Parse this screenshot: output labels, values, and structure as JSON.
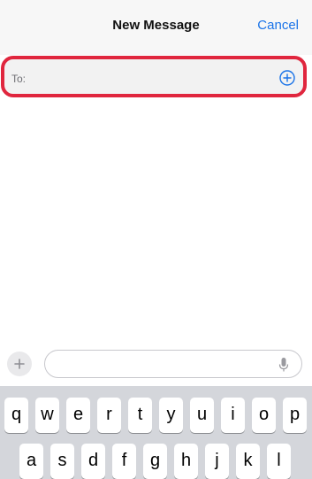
{
  "header": {
    "title": "New Message",
    "cancel_label": "Cancel"
  },
  "recipient": {
    "label": "To:",
    "value": "",
    "add_icon": "plus-circle-icon"
  },
  "compose": {
    "attach_icon": "plus-icon",
    "message_value": "",
    "mic_icon": "microphone-icon"
  },
  "keyboard": {
    "row1": [
      "q",
      "w",
      "e",
      "r",
      "t",
      "y",
      "u",
      "i",
      "o",
      "p"
    ],
    "row2": [
      "a",
      "s",
      "d",
      "f",
      "g",
      "h",
      "j",
      "k",
      "l"
    ]
  },
  "colors": {
    "accent": "#1a73e8",
    "highlight": "#e0263e",
    "keyboard_bg": "#d4d6db"
  }
}
